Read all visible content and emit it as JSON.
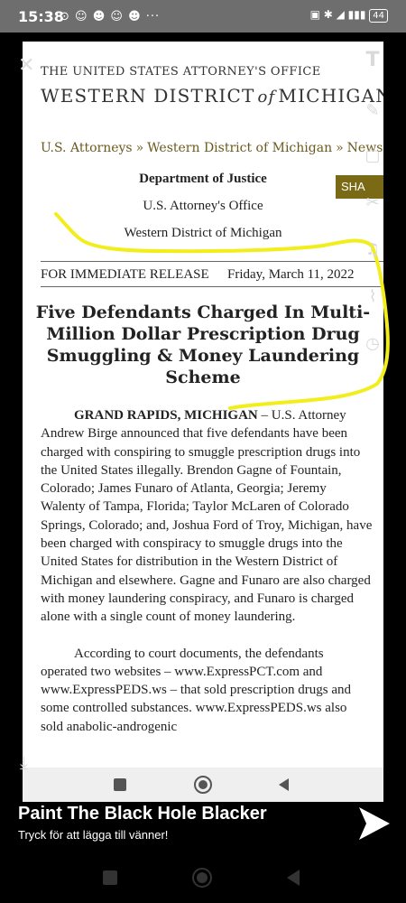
{
  "status_bar": {
    "time": "15:38",
    "battery": "44"
  },
  "site_header": {
    "office": "THE UNITED STATES ATTORNEY'S OFFICE",
    "district_left": "WESTERN DISTRICT",
    "district_of": "of",
    "district_right": "MICHIGAN"
  },
  "breadcrumb": {
    "items": [
      "U.S. Attorneys",
      "Western District of Michigan",
      "News"
    ],
    "separator": "»"
  },
  "share_label": "SHA",
  "agency": {
    "department": "Department of Justice",
    "office": "U.S. Attorney's Office",
    "district": "Western District of Michigan"
  },
  "release": {
    "label": "FOR IMMEDIATE RELEASE",
    "date": "Friday, March 11, 2022"
  },
  "headline": "Five Defendants Charged In Multi-Million Dollar Prescription Drug Smuggling & Money Laundering Scheme",
  "body": {
    "dateline": "GRAND RAPIDS, MICHIGAN",
    "p1": " – U.S. Attorney Andrew Birge announced that five defendants have been charged with conspiring to smuggle prescription drugs into the United States illegally. Brendon Gagne of Fountain, Colorado; James Funaro of Atlanta, Georgia; Jeremy Walenty of Tampa, Florida; Taylor McLaren of Colorado Springs, Colorado; and, Joshua Ford of Troy, Michigan, have been charged with conspiracy to smuggle drugs into the United States for distribution in the Western District of Michigan and elsewhere. Gagne and Funaro are also charged with money laundering conspiracy, and Funaro is charged alone with a single count of money laundering.",
    "p2": "According to court documents, the defendants operated two websites – www.ExpressPCT.com and www.ExpressPEDS.ws – that sold prescription drugs and some controlled substances. www.ExpressPEDS.ws also sold anabolic-androgenic"
  },
  "promo": {
    "title": "Paint The Black Hole Blacker",
    "subtitle": "Tryck för att lägga till vänner!"
  },
  "colors": {
    "accent": "#7a6a16",
    "link": "#6b5a1e",
    "annotation": "#f2ee1c"
  }
}
